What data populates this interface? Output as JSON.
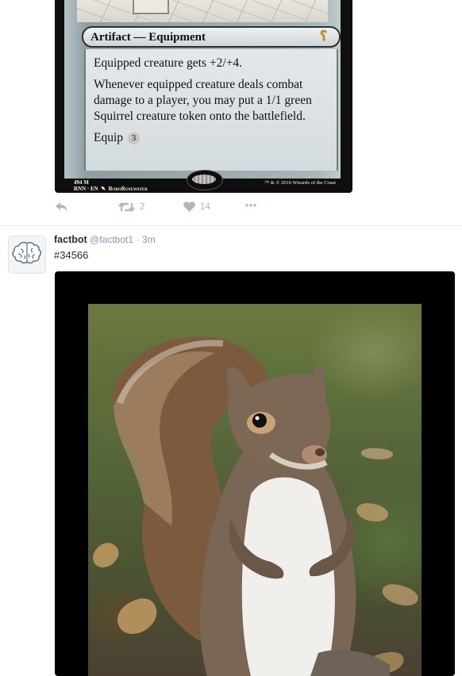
{
  "card": {
    "type_line": "Artifact — Equipment",
    "rules": [
      "Equipped creature gets +2/+4.",
      "Whenever equipped creature deals combat damage to a player, you may put a 1/1 green Squirrel creature token onto the battlefield."
    ],
    "equip_label": "Equip",
    "equip_cost": "3",
    "collector_number": "494 M",
    "set_info": "RNN · EN",
    "artist": "RoboRosewater",
    "copyright": "™ & © 2016 Wizards of the Coast"
  },
  "tweet1_actions": {
    "retweet_count": "2",
    "like_count": "14",
    "more_label": "•••"
  },
  "tweet2": {
    "name": "factbot",
    "handle": "@factbot1",
    "separator": "·",
    "time": "3m",
    "text": "#34566"
  },
  "icons": {
    "reply": "reply-icon",
    "retweet": "retweet-icon",
    "like": "heart-icon",
    "more": "more-icon",
    "avatar": "brain-icon"
  },
  "colors": {
    "action_gray": "#aab8c2",
    "name_text": "#292f33",
    "meta_text": "#8899a6"
  }
}
